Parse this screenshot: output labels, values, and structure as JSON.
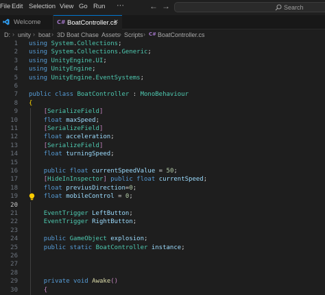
{
  "menu": [
    "File",
    "Edit",
    "Selection",
    "View",
    "Go",
    "Run",
    "···"
  ],
  "nav": {
    "back": "←",
    "forward": "→"
  },
  "search": {
    "label": "Search"
  },
  "tabs": [
    {
      "label": "Welcome",
      "icon": "vscode-logo-icon"
    },
    {
      "label": "BoatController.cs",
      "icon": "csharp-file-icon",
      "close": "×"
    }
  ],
  "breadcrumb": [
    "D:",
    "unity",
    "boat",
    "3D Boat Chase",
    "Assets",
    "Scripts",
    "BoatController.cs"
  ],
  "editor": {
    "current_line": 19,
    "lines": [
      {
        "n": "1",
        "code": "using System.Collections;"
      },
      {
        "n": "2",
        "code": "using System.Collections.Generic;"
      },
      {
        "n": "3",
        "code": "using UnityEngine.UI;"
      },
      {
        "n": "4",
        "code": "using UnityEngine;"
      },
      {
        "n": "5",
        "code": "using UnityEngine.EventSystems;"
      },
      {
        "n": "6",
        "code": ""
      },
      {
        "n": "7",
        "code": "public class BoatController : MonoBehaviour"
      },
      {
        "n": "8",
        "code": "{"
      },
      {
        "n": "9",
        "code": "    [SerializeField]"
      },
      {
        "n": "10",
        "code": "    float maxSpeed;"
      },
      {
        "n": "11",
        "code": "    [SerializeField]"
      },
      {
        "n": "12",
        "code": "    float acceleration;"
      },
      {
        "n": "13",
        "code": "    [SerializeField]"
      },
      {
        "n": "14",
        "code": "    float turningSpeed;"
      },
      {
        "n": "15",
        "code": ""
      },
      {
        "n": "16",
        "code": "    public float currentSpeedValue = 50;"
      },
      {
        "n": "17",
        "code": "    [HideInInspector] public float currentSpeed;"
      },
      {
        "n": "18",
        "code": "    float previusDirection=0;"
      },
      {
        "n": "19",
        "code": "    float mobileControl = 0;"
      },
      {
        "n": "20",
        "code": ""
      },
      {
        "n": "21",
        "code": "    EventTrigger LeftButton;"
      },
      {
        "n": "22",
        "code": "    EventTrigger RightButton;"
      },
      {
        "n": "23",
        "code": ""
      },
      {
        "n": "24",
        "code": "    public GameObject explosion;"
      },
      {
        "n": "25",
        "code": "    public static BoatController instance;"
      },
      {
        "n": "26",
        "code": ""
      },
      {
        "n": "27",
        "code": ""
      },
      {
        "n": "28",
        "code": ""
      },
      {
        "n": "29",
        "code": "    private void Awake()"
      },
      {
        "n": "30",
        "code": "    {"
      }
    ]
  },
  "colors": {
    "keyword": "#569cd6",
    "type": "#4ec9b0",
    "variable": "#9cdcfe",
    "number": "#b5cea8",
    "function": "#dcdcaa",
    "attribute": "#c586c0",
    "accent": "#0078d4",
    "lightbulb": "#ffcc00"
  }
}
